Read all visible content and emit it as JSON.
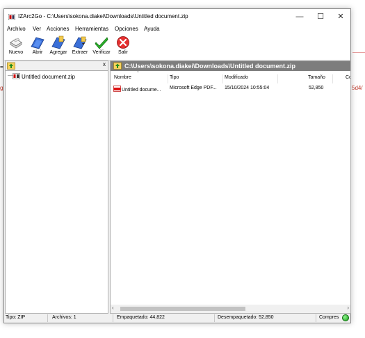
{
  "background": {
    "left_glyph_1": "=",
    "left_glyph_2": "g",
    "right_text": "5d4/"
  },
  "window": {
    "title": "IZArc2Go - C:\\Users\\sokona.diakei\\Downloads\\Untitled document.zip",
    "minimize": "—",
    "maximize": "☐",
    "close": "✕"
  },
  "menu": [
    "Archivo",
    "Ver",
    "Acciones",
    "Herramientas",
    "Opciones",
    "Ayuda"
  ],
  "toolbar": {
    "new": "Nuevo",
    "open": "Abrir",
    "add": "Agregar",
    "extract": "Extraer",
    "verify": "Verificar",
    "exit": "Salir"
  },
  "tree": {
    "close": "x",
    "root": "Untitled document.zip"
  },
  "path": "C:\\Users\\sokona.diakei\\Downloads\\Untitled document.zip",
  "columns": {
    "name": "Nombre",
    "type": "Tipo",
    "modified": "Modificado",
    "size": "Tamaño",
    "compressed": "Co"
  },
  "files": [
    {
      "name": "Untitled docume...",
      "type": "Microsoft Edge PDF...",
      "modified": "15/10/2024 10:55:04",
      "size": "52,850"
    }
  ],
  "scrollbar": {
    "left_arrow": "‹",
    "right_arrow": "›"
  },
  "status": {
    "type": "Tipo: ZIP",
    "files": "Archivos: 1",
    "packed": "Empaquetado: 44,822",
    "unpacked": "Desempaquetado: 52,850",
    "ratio": "Compres"
  },
  "colors": {
    "path_bar": "#7d7d7d",
    "status_ok": "#18a018"
  }
}
